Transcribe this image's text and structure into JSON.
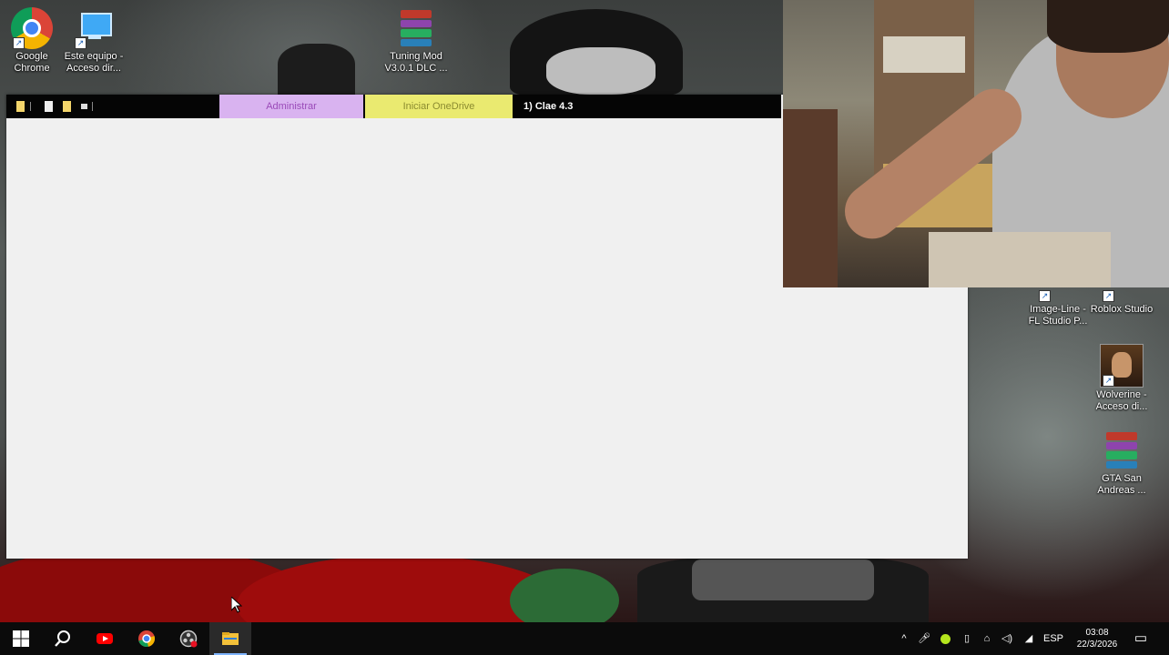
{
  "desktop": {
    "icons": [
      {
        "id": "chrome",
        "label": "Google Chrome"
      },
      {
        "id": "this-pc",
        "label": "Este equipo - Acceso dir..."
      },
      {
        "id": "tuning-mod",
        "label": "Tuning Mod V3.0.1 DLC ..."
      },
      {
        "id": "fl-studio",
        "label": "Image-Line - FL Studio P..."
      },
      {
        "id": "roblox-studio",
        "label": "Roblox Studio"
      },
      {
        "id": "wolverine",
        "label": "Wolverine - Acceso di..."
      },
      {
        "id": "gta-san-andreas",
        "label": "GTA San Andreas ..."
      }
    ]
  },
  "app_window": {
    "ribbon": {
      "tabs": [
        {
          "label": "Administrar",
          "color": "#d9b3f0"
        },
        {
          "label": "Iniciar OneDrive",
          "color": "#eaea70"
        },
        {
          "label": "1) Clae 4.3"
        }
      ]
    }
  },
  "taskbar": {
    "apps": [
      {
        "name": "start",
        "icon": "windows-icon"
      },
      {
        "name": "search",
        "icon": "search-icon"
      },
      {
        "name": "youtube",
        "icon": "youtube-icon"
      },
      {
        "name": "chrome",
        "icon": "chrome-icon"
      },
      {
        "name": "obs",
        "icon": "obs-icon"
      },
      {
        "name": "file-explorer",
        "icon": "folder-icon",
        "active": true
      }
    ],
    "tray": {
      "language": "ESP",
      "time": "03:08",
      "date": "22/3/2026"
    }
  }
}
